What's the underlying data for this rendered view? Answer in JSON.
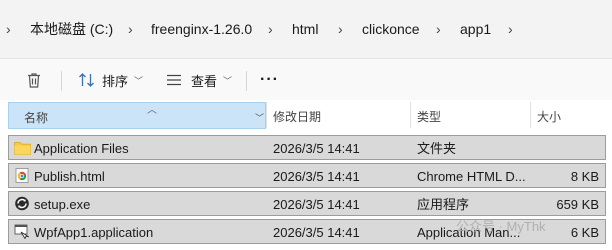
{
  "breadcrumb": {
    "items": [
      "本地磁盘 (C:)",
      "freenginx-1.26.0",
      "html",
      "clickonce",
      "app1"
    ]
  },
  "toolbar": {
    "sort_label": "排序",
    "view_label": "查看",
    "more_label": "···"
  },
  "columns": {
    "name": "名称",
    "modified": "修改日期",
    "type": "类型",
    "size": "大小"
  },
  "files": [
    {
      "icon": "folder-icon",
      "name": "Application Files",
      "modified": "2026/3/5 14:41",
      "type": "文件夹",
      "size": ""
    },
    {
      "icon": "chrome-html-icon",
      "name": "Publish.html",
      "modified": "2026/3/5 14:41",
      "type": "Chrome HTML D...",
      "size": "8 KB"
    },
    {
      "icon": "setup-exe-icon",
      "name": "setup.exe",
      "modified": "2026/3/5 14:41",
      "type": "应用程序",
      "size": "659 KB"
    },
    {
      "icon": "application-manifest-icon",
      "name": "WpfApp1.application",
      "modified": "2026/3/5 14:41",
      "type": "Application Man...",
      "size": "6 KB"
    }
  ],
  "watermark": "公众号 · MyThk"
}
